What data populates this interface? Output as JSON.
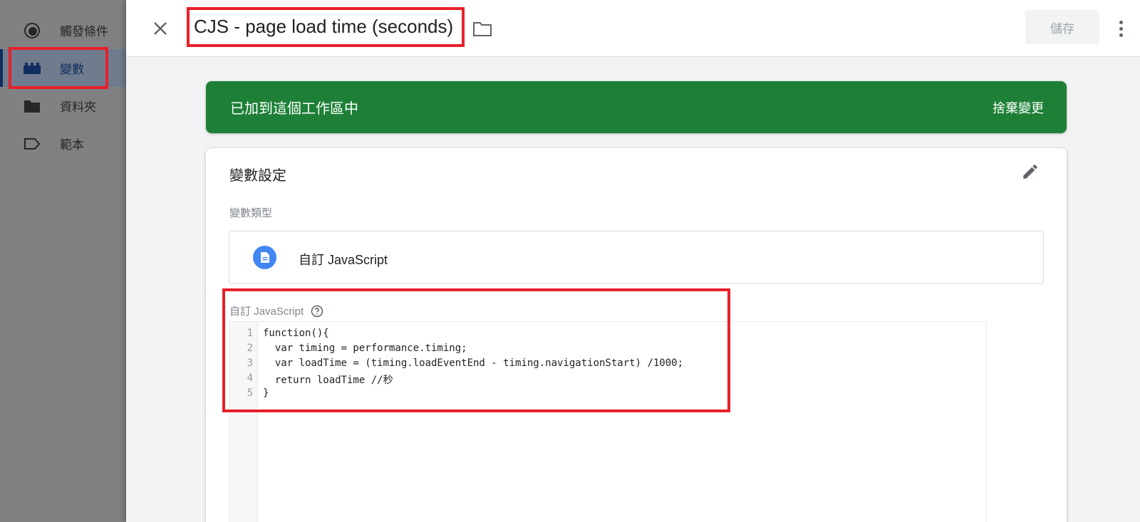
{
  "nav": {
    "items": [
      {
        "label": "觸發條件",
        "icon": "trigger-icon"
      },
      {
        "label": "變數",
        "icon": "variable-icon",
        "active": true
      },
      {
        "label": "資料夾",
        "icon": "folder-icon"
      },
      {
        "label": "範本",
        "icon": "template-icon"
      }
    ]
  },
  "header": {
    "title": "CJS - page load time (seconds)",
    "save_label": "儲存"
  },
  "banner": {
    "text": "已加到這個工作區中",
    "action": "捨棄變更",
    "color": "#1e8037"
  },
  "card": {
    "title": "變數設定",
    "type_label": "變數類型",
    "type_value": "自訂 JavaScript",
    "code_label": "自訂 JavaScript"
  },
  "code": {
    "line_numbers": [
      "1",
      "2",
      "3",
      "4",
      "5"
    ],
    "lines": [
      "function(){",
      "  var timing = performance.timing;",
      "  var loadTime = (timing.loadEventEnd - timing.navigationStart) /1000;",
      "  return loadTime //秒",
      "}"
    ]
  },
  "colors": {
    "highlight": "#e8202a",
    "accent": "#4285f4",
    "nav_active": "#1a4a9c"
  }
}
